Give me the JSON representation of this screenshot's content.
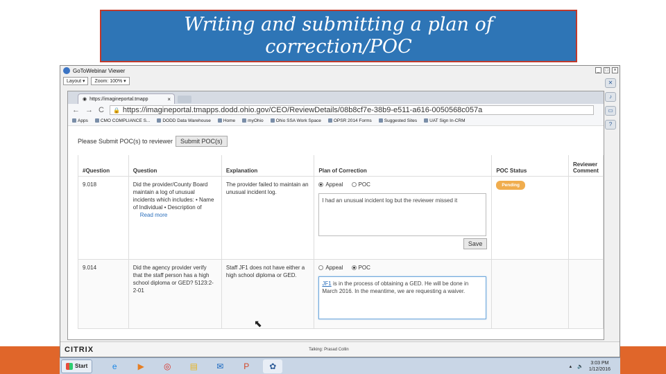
{
  "slide": {
    "title": "Writing and submitting a plan of\ncorrection/POC"
  },
  "gtw": {
    "window_title": "GoToWebinar Viewer",
    "layout_label": "Layout ▾",
    "zoom_label": "Zoom: 100% ▾",
    "footer_brand": "CITRIX",
    "talking_text": "Talking: Prasad Collin"
  },
  "browser": {
    "tab_title": "https://imagineportal.tmapp",
    "url": "https://imagineportal.tmapps.dodd.ohio.gov/CEO/ReviewDetails/08b8cf7e-38b9-e511-a616-0050568c057a",
    "bookmarks": [
      "Apps",
      "CMO COMPLIANCE S...",
      "DODD Data Warehouse",
      "Home",
      "myOhio",
      "Ohio SSA Work Space",
      "OPSR 2014 Forms",
      "Suggested Sites",
      "UAT Sign In-CRM"
    ]
  },
  "page": {
    "submit_prompt": "Please Submit POC(s) to reviewer",
    "submit_button": "Submit POC(s)",
    "columns": [
      "#Question",
      "Question",
      "Explanation",
      "Plan of Correction",
      "POC Status",
      "Reviewer Comment"
    ],
    "rows": [
      {
        "number": "9.018",
        "question": "Did the provider/County Board maintain a log of unusual incidents which includes: • Name of Individual • Description of",
        "read_more": "Read more",
        "explanation": "The provider failed to maintain an unusual incident log.",
        "option_appeal": "Appeal",
        "option_poc": "POC",
        "plan_text": "I had an unusual incident log but the reviewer missed it",
        "save_label": "Save",
        "status": "Pending"
      },
      {
        "number": "9.014",
        "question": "Did the agency provider verify that the staff person has a high school diploma or GED? 5123:2-2-01",
        "explanation": "Staff JF1 does not have either a high school diploma or GED.",
        "option_appeal": "Appeal",
        "option_poc": "POC",
        "plan_link": "JF1",
        "plan_text_rest": " is in the process of obtaining a GED. He will be done in March 2016. In the meantime, we are requesting a waiver."
      }
    ]
  },
  "taskbar": {
    "start_label": "Start",
    "time": "3:03 PM",
    "date": "1/12/2016"
  },
  "colors": {
    "title_bg": "#2e75b6",
    "footer_band": "#e0662a",
    "pending_badge": "#f0ad4e"
  }
}
